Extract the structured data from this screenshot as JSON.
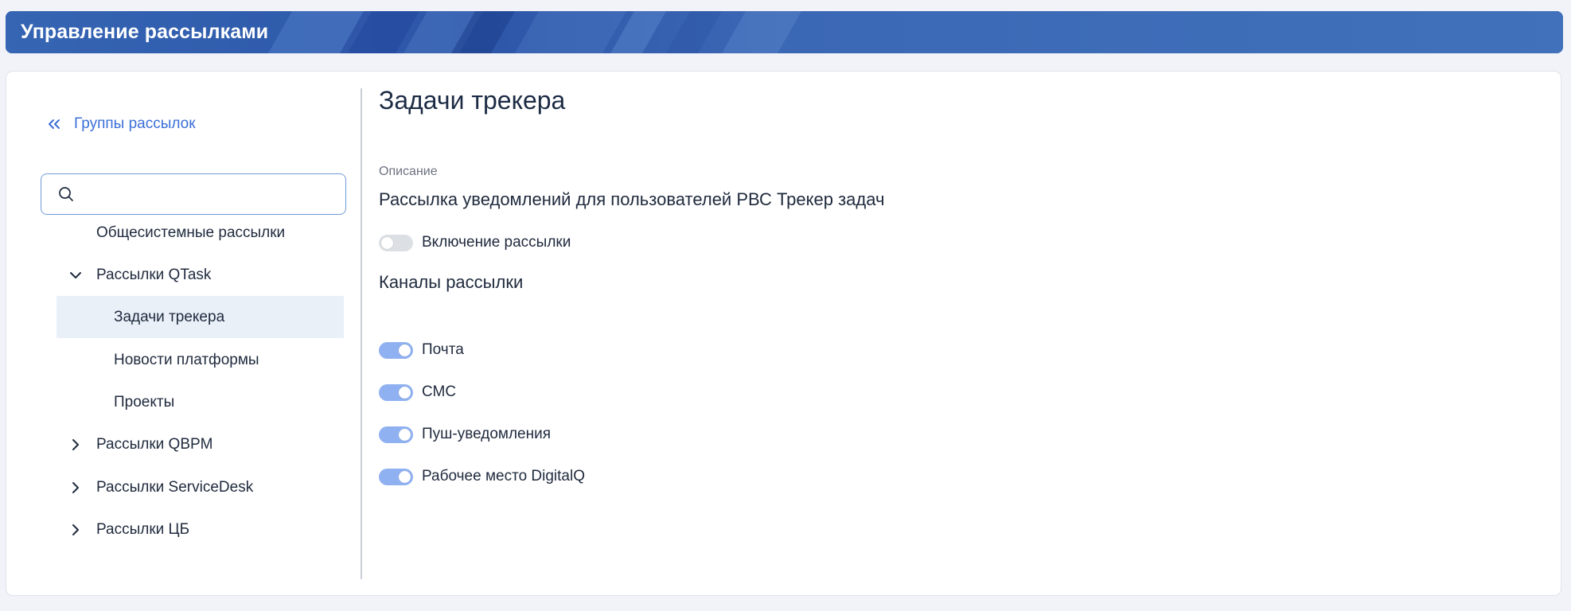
{
  "header": {
    "title": "Управление рассылками"
  },
  "sidebar": {
    "back_link": "Группы рассылок",
    "search": {
      "value": "",
      "placeholder": ""
    },
    "tree": [
      {
        "label": "Общесистемные рассылки",
        "level": 1,
        "toggle": "none",
        "selected": false
      },
      {
        "label": "Рассылки QTask",
        "level": 1,
        "toggle": "expanded",
        "selected": false
      },
      {
        "label": "Задачи трекера",
        "level": 2,
        "toggle": "none",
        "selected": true
      },
      {
        "label": "Новости платформы",
        "level": 2,
        "toggle": "none",
        "selected": false
      },
      {
        "label": "Проекты",
        "level": 2,
        "toggle": "none",
        "selected": false
      },
      {
        "label": "Рассылки QBPM",
        "level": 1,
        "toggle": "collapsed",
        "selected": false
      },
      {
        "label": "Рассылки ServiceDesk",
        "level": 1,
        "toggle": "collapsed",
        "selected": false
      },
      {
        "label": "Рассылки ЦБ",
        "level": 1,
        "toggle": "collapsed",
        "selected": false
      }
    ]
  },
  "main": {
    "title": "Задачи трекера",
    "description_label": "Описание",
    "description": "Рассылка уведомлений для пользователей РВС Трекер задач",
    "enable": {
      "label": "Включение рассылки",
      "on": false
    },
    "channels_title": "Каналы рассылки",
    "channels": [
      {
        "label": "Почта",
        "on": true
      },
      {
        "label": "СМС",
        "on": true
      },
      {
        "label": "Пуш-уведомления",
        "on": true
      },
      {
        "label": "Рабочее место DigitalQ",
        "on": true
      }
    ]
  },
  "colors": {
    "accent": "#3b6fd6",
    "banner": "#3e6ab7",
    "switch_on": "#90b1f1",
    "switch_off": "#dcdfe4",
    "selected_row": "#e9f0f8"
  },
  "icons": {
    "back": "double-chevron-left-icon",
    "search": "search-icon",
    "expanded": "chevron-down-icon",
    "collapsed": "chevron-right-icon"
  }
}
